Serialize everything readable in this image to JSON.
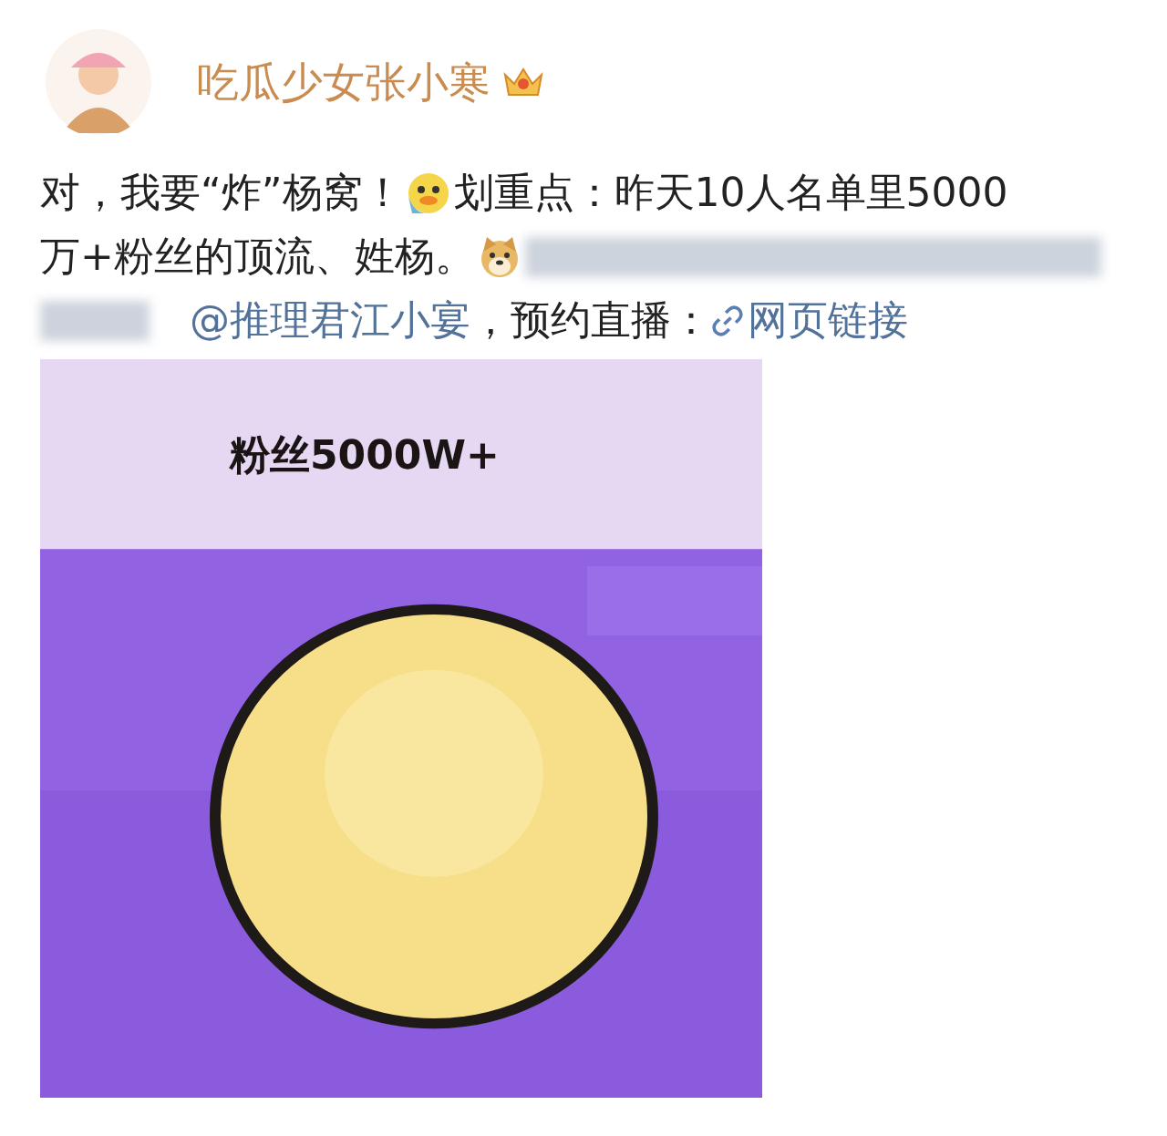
{
  "author": {
    "name": "吃瓜少女张小寒"
  },
  "post": {
    "lines": [
      [
        {
          "kind": "text",
          "text": "对，我要“炸”杨窝！"
        },
        {
          "kind": "duck"
        },
        {
          "kind": "text",
          "text": "划重点：昨天10人名单里5000"
        }
      ],
      [
        {
          "kind": "text",
          "text": "万+粉丝的顶流、姓杨。"
        },
        {
          "kind": "dog"
        },
        {
          "kind": "blur"
        }
      ],
      [
        {
          "kind": "blur"
        },
        {
          "kind": "mention",
          "text": "@推理君江小宴"
        },
        {
          "kind": "text",
          "text": "，预约直播："
        },
        {
          "kind": "link",
          "text": "网页链接"
        }
      ]
    ]
  },
  "image": {
    "kind": "picture",
    "caption": "粉丝5000W+"
  }
}
